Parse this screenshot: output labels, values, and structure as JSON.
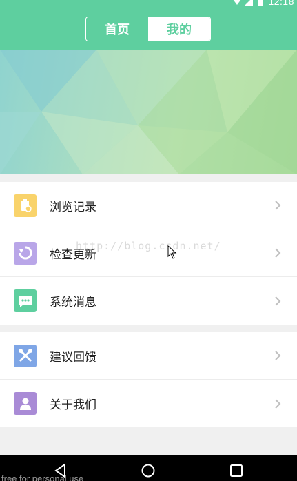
{
  "status_bar": {
    "time": "12:18",
    "icons": [
      "wifi-icon",
      "signal-icon",
      "battery-icon"
    ]
  },
  "header": {
    "tabs": [
      {
        "label": "首页",
        "active": false
      },
      {
        "label": "我的",
        "active": true
      }
    ]
  },
  "colors": {
    "accent": "#5ecf9f",
    "history_icon": "#f9d36b",
    "update_icon": "#b9a6e8",
    "messages_icon": "#5ecf9f",
    "feedback_icon": "#7fa6e6",
    "about_icon": "#a98bd6",
    "chevron": "#bfbfbf"
  },
  "menu": {
    "group1": [
      {
        "label": "浏览记录",
        "icon": "history-icon"
      },
      {
        "label": "检查更新",
        "icon": "update-icon"
      },
      {
        "label": "系统消息",
        "icon": "message-icon"
      }
    ],
    "group2": [
      {
        "label": "建议回馈",
        "icon": "tools-icon"
      },
      {
        "label": "关于我们",
        "icon": "about-icon"
      }
    ]
  },
  "watermark": "http://blog.csdn.net/",
  "footer_text": "free for personal use"
}
